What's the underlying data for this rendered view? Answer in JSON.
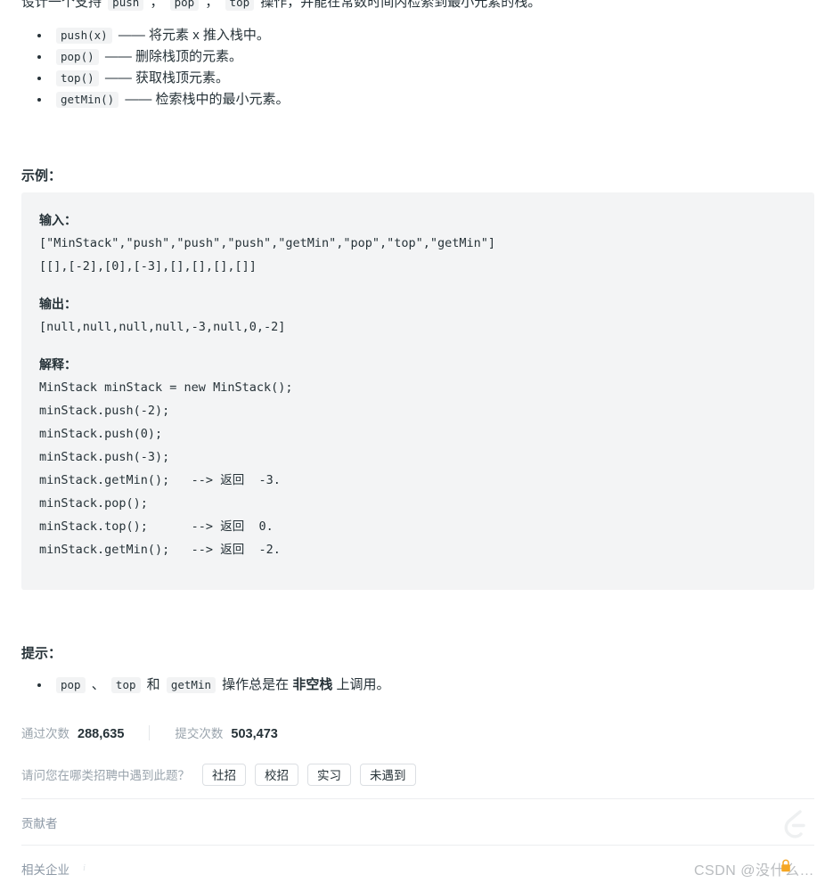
{
  "intro": {
    "prefix": "设计一个支持 ",
    "code1": "push",
    "sep1": " ， ",
    "code2": "pop",
    "sep2": " ， ",
    "code3": "top",
    "suffix": " 操作，并能在常数时间内检索到最小元素的栈。"
  },
  "operations": [
    {
      "code": "push(x)",
      "desc": "—— 将元素 x 推入栈中。"
    },
    {
      "code": "pop()",
      "desc": "—— 删除栈顶的元素。"
    },
    {
      "code": "top()",
      "desc": "—— 获取栈顶元素。"
    },
    {
      "code": "getMin()",
      "desc": "—— 检索栈中的最小元素。"
    }
  ],
  "example": {
    "heading": "示例：",
    "input_label": "输入：",
    "input_lines": [
      "[\"MinStack\",\"push\",\"push\",\"push\",\"getMin\",\"pop\",\"top\",\"getMin\"]",
      "[[],[-2],[0],[-3],[],[],[],[]]"
    ],
    "output_label": "输出：",
    "output_lines": [
      "[null,null,null,null,-3,null,0,-2]"
    ],
    "explain_label": "解释：",
    "explain_lines": [
      "MinStack minStack = new MinStack();",
      "minStack.push(-2);",
      "minStack.push(0);",
      "minStack.push(-3);",
      "minStack.getMin();   --> 返回  -3.",
      "minStack.pop();",
      "minStack.top();      --> 返回  0.",
      "minStack.getMin();   --> 返回  -2."
    ]
  },
  "hints": {
    "heading": "提示：",
    "item": {
      "code1": "pop",
      "sep1": " 、 ",
      "code2": "top",
      "sep2": " 和 ",
      "code3": "getMin",
      "mid": " 操作总是在 ",
      "bold": "非空栈",
      "tail": " 上调用。"
    }
  },
  "stats": {
    "accepted_label": "通过次数",
    "accepted_value": "288,635",
    "submissions_label": "提交次数",
    "submissions_value": "503,473"
  },
  "survey": {
    "question": "请问您在哪类招聘中遇到此题？",
    "options": [
      "社招",
      "校招",
      "实习",
      "未遇到"
    ]
  },
  "footer": {
    "contributor_label": "贡献者",
    "companies_label": "相关企业",
    "info_icon": "i"
  },
  "watermark": {
    "text": "CSDN @没什么…"
  },
  "colors": {
    "text": "#263238",
    "muted": "#9aa4ad",
    "chip_bg": "#f2f3f4",
    "panel_bg": "#f3f4f5",
    "border": "#dcdfe3",
    "divider": "#eceef0",
    "watermark_accent": "#f5a623"
  }
}
